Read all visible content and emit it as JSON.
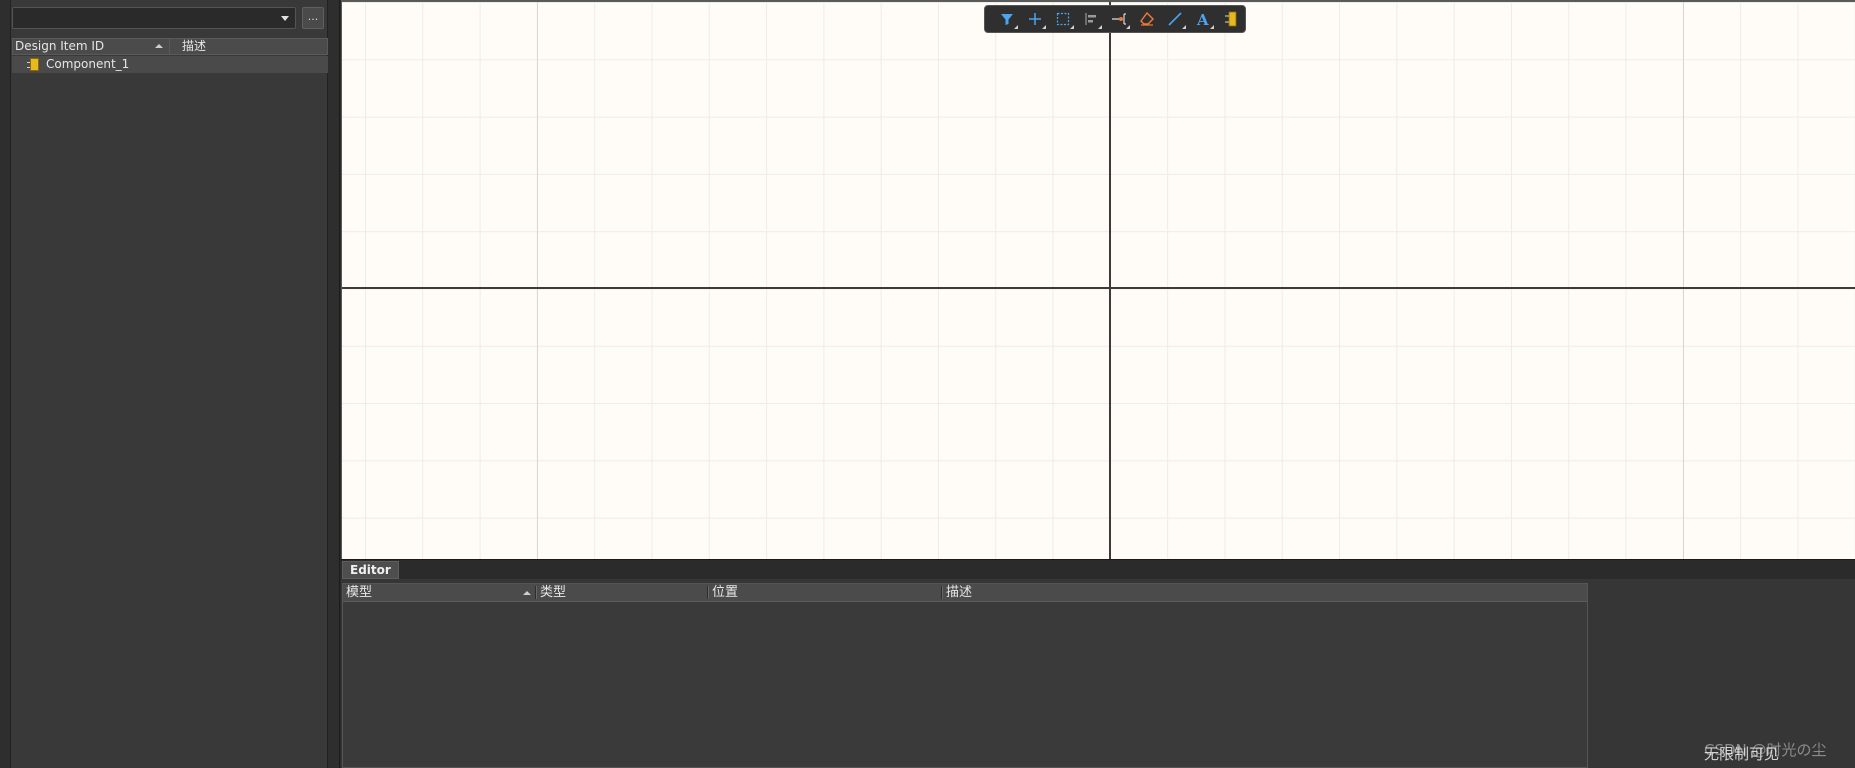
{
  "library_panel": {
    "dropdown_value": "",
    "more_button_label": "...",
    "table": {
      "columns": [
        "Design Item ID",
        "描述"
      ],
      "rows": [
        {
          "design_item_id": "Component_1",
          "description": ""
        }
      ]
    }
  },
  "toolbar": {
    "tools": [
      "filter-icon",
      "add-cross-icon",
      "select-rect-icon",
      "align-icon",
      "place-pin-icon",
      "eraser-icon",
      "line-icon",
      "text-icon",
      "component-icon"
    ]
  },
  "editor": {
    "tab_label": "Editor",
    "columns": [
      "模型",
      "类型",
      "位置",
      "描述"
    ]
  },
  "watermark": {
    "text_back": "CSDN @时光の尘",
    "text_front": "无限制可见"
  },
  "colors": {
    "canvas_background": "#fffcf7",
    "panel_background": "#393939",
    "component_icon": "#e8b820",
    "tool_accent_blue": "#4ea3f0",
    "tool_accent_orange": "#f07a3a"
  }
}
